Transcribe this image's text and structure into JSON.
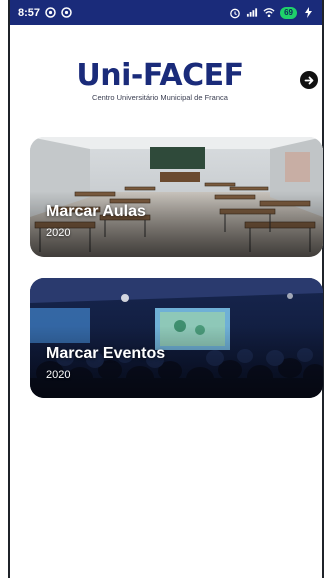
{
  "status_bar": {
    "time": "8:57",
    "battery": "69",
    "left_icons": [
      "notification-icon",
      "notification-icon"
    ],
    "right_icons": [
      "alarm-icon",
      "signal-icon",
      "wifi-icon",
      "battery-icon",
      "charging-icon"
    ]
  },
  "header": {
    "logo_text": "Uni-FACEF",
    "logo_subtitle": "Centro Universitário Municipal de Franca",
    "next_icon": "arrow-right-icon"
  },
  "cards": [
    {
      "title": "Marcar Aulas",
      "year": "2020",
      "image": "classroom-photo"
    },
    {
      "title": "Marcar Eventos",
      "year": "2020",
      "image": "auditorium-photo"
    }
  ],
  "colors": {
    "status_bar": "#1a2b7a",
    "logo": "#1a2b7a",
    "battery": "#1fd16a"
  }
}
